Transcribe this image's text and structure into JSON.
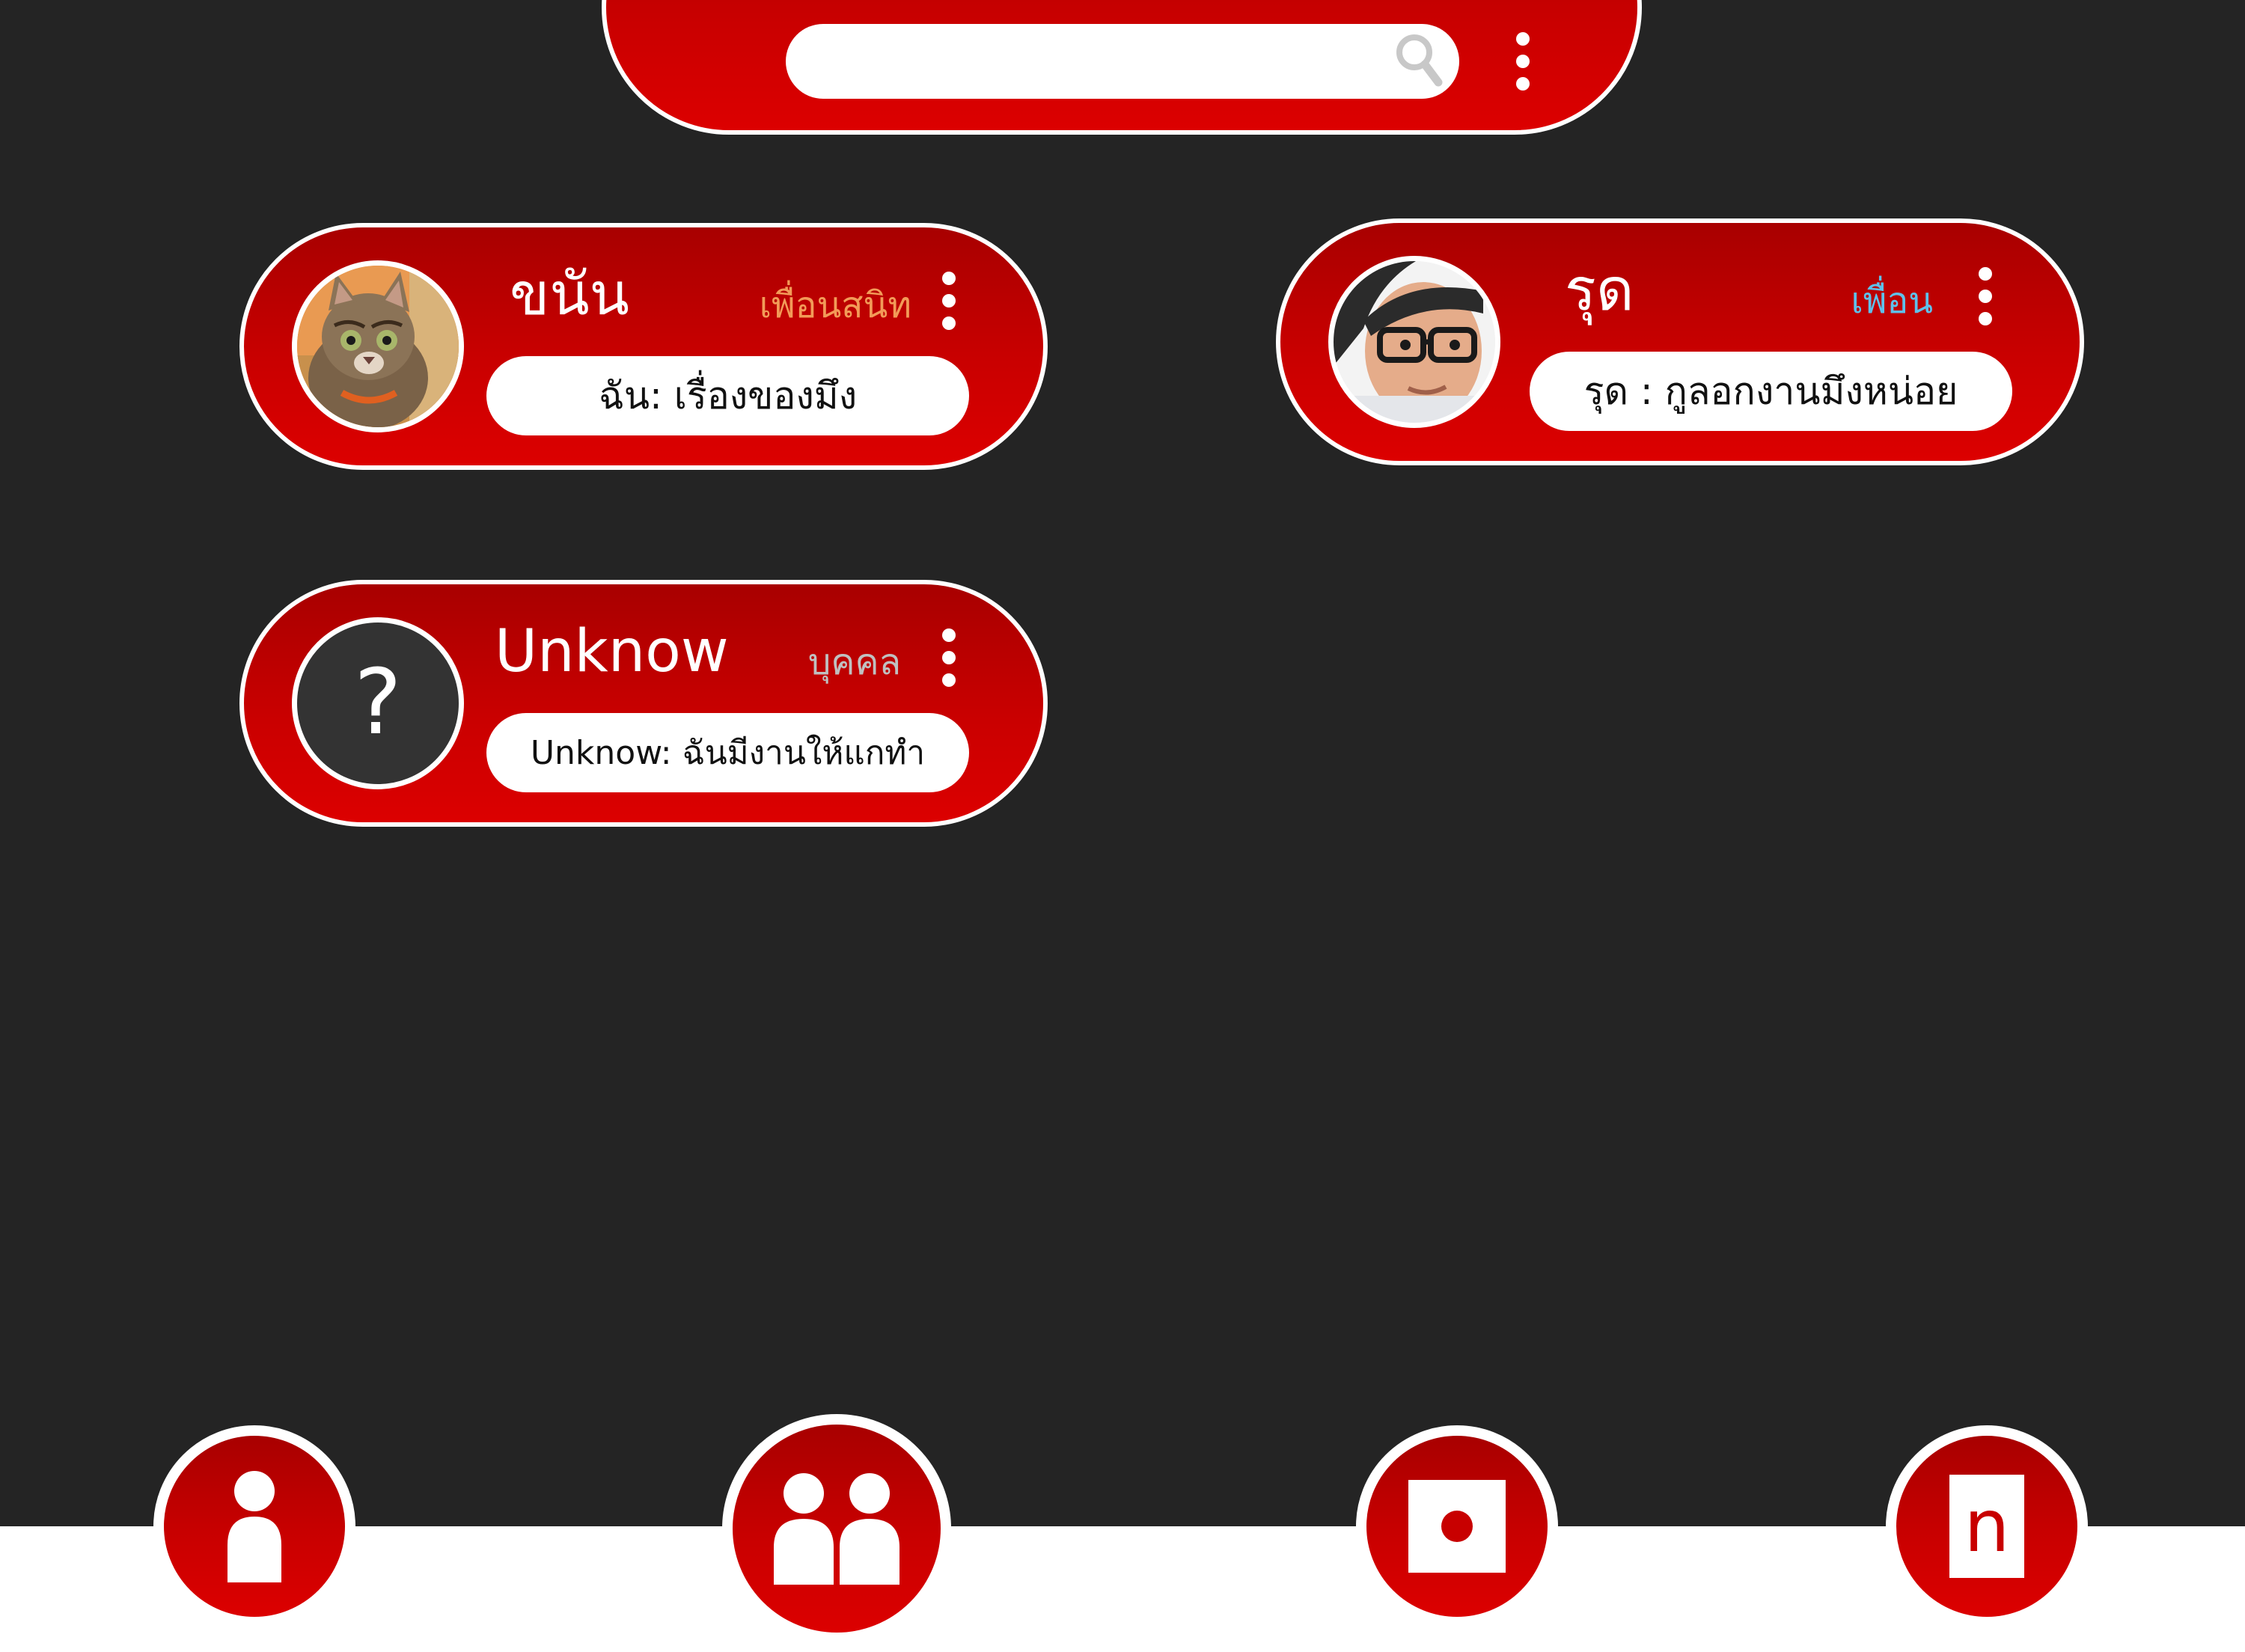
{
  "colors": {
    "background": "#242424",
    "accent_red": "#c90000",
    "white": "#ffffff",
    "relation_close_friend": "#f29b58",
    "relation_friend": "#5fc0ea",
    "relation_person": "#c0c0c0"
  },
  "search": {
    "placeholder": "",
    "icon": "search-icon",
    "menu_icon": "kebab-icon"
  },
  "chats": [
    {
      "name": "ขนัน",
      "relation": "เพื่อนสนิท",
      "message": "ฉัน: เรื่องของมึง",
      "avatar": "cat-photo"
    },
    {
      "name": "รุด",
      "relation": "เพื่อน",
      "message": "รุด : กูลอกงานมึงหน่อย",
      "avatar": "person-photo"
    },
    {
      "name": "Unknow",
      "relation": "บุคคล",
      "message": "Unknow: ฉันมีงานให้แกทำ",
      "avatar": "question-mark",
      "avatar_glyph": "?"
    }
  ],
  "nav": [
    {
      "icon": "person-icon"
    },
    {
      "icon": "group-icon"
    },
    {
      "icon": "square-dot-icon"
    },
    {
      "icon": "door-icon",
      "glyph": "n"
    }
  ]
}
